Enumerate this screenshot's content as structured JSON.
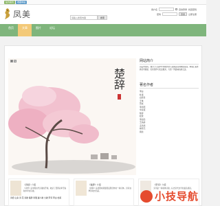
{
  "topbar": {
    "tag1": "设为首页",
    "tag2": "收藏本站"
  },
  "header": {
    "logo_text": "凤美",
    "account": {
      "user_label": "用户名",
      "user_value": "",
      "pwd_label": "密码",
      "remember": "自动登录",
      "retrieve": "找回密码",
      "login": "登录",
      "register": "立即注册"
    },
    "search": {
      "placeholder": "请输入搜索内容",
      "button": "搜索"
    }
  },
  "nav": [
    {
      "label": "首页"
    },
    {
      "label": "文章"
    },
    {
      "label": "图片"
    },
    {
      "label": "论坛"
    }
  ],
  "slider": {
    "numbers": [
      "1",
      "2"
    ],
    "calligraphy": "楚辞"
  },
  "sidebar": {
    "intro_title": "网站简介",
    "intro_text": "凤美中国风，致力于打造中华传统文化与古典意境的网络家园。本站汇集经典诗词歌赋、名家画作与优美散文，与您一同品味古韵之美。",
    "authors_title": "著名作者",
    "authors": [
      "李白",
      "杜甫",
      "白居易",
      "王维",
      "苏轼",
      "李清照",
      "辛弃疾",
      "陆游",
      "杜牧",
      "李商隐",
      "王昌龄",
      "孟浩然",
      "柳宗元",
      "韩愈"
    ]
  },
  "cards": [
    {
      "title": "《诗经》介绍",
      "text": "《诗经》是中国古代诗歌的开端，收录了西周初年至春秋中叶的诗歌。",
      "tags": "诗经 山鬼 诗 花 诗歌 楚辞 离骚 越人歌 九歌 宋词 李白 杜甫"
    },
    {
      "title": "《楚辞》介绍",
      "text": "《楚辞》是战国时期楚国屈原创作的一种诗体，具有浓厚的地方色彩。",
      "tags": ""
    },
    {
      "title": "《宋词》介绍",
      "text": "宋词是一种新体诗歌，标志宋代文学的最高成就。",
      "tags": ""
    }
  ],
  "watermark": {
    "text": "小技导航"
  }
}
